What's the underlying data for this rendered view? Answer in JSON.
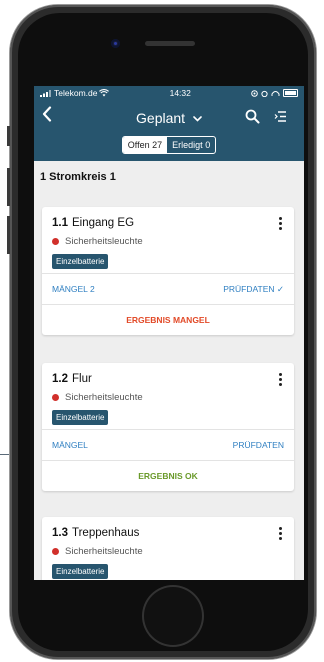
{
  "statusbar": {
    "carrier": "Telekom.de",
    "time": "14:32"
  },
  "appbar": {
    "title": "Geplant",
    "dropdown_icon": "chevron-down-icon",
    "search_icon": "search-icon",
    "menu_icon": "sort-list-icon"
  },
  "filter": {
    "open_label": "Offen 27",
    "done_label": "Erledigt 0"
  },
  "section": {
    "title": "1 Stromkreis 1"
  },
  "cards": [
    {
      "number": "1.1",
      "title": "Eingang EG",
      "status_text": "Sicherheitsleuchte",
      "tag": "Einzelbatterie",
      "defects_label": "MÄNGEL 2",
      "data_label": "PRÜFDATEN ✓",
      "result": "ERGEBNIS MANGEL"
    },
    {
      "number": "1.2",
      "title": "Flur",
      "status_text": "Sicherheitsleuchte",
      "tag": "Einzelbatterie",
      "defects_label": "MÄNGEL",
      "data_label": "PRÜFDATEN",
      "result": "ERGEBNIS OK"
    },
    {
      "number": "1.3",
      "title": "Treppenhaus",
      "status_text": "Sicherheitsleuchte",
      "tag": "Einzelbatterie"
    }
  ],
  "colors": {
    "primary": "#27556e",
    "link": "#2f7fc1",
    "defect": "#e24a28",
    "ok": "#6a9a2a",
    "status_dot": "#d1302b"
  }
}
